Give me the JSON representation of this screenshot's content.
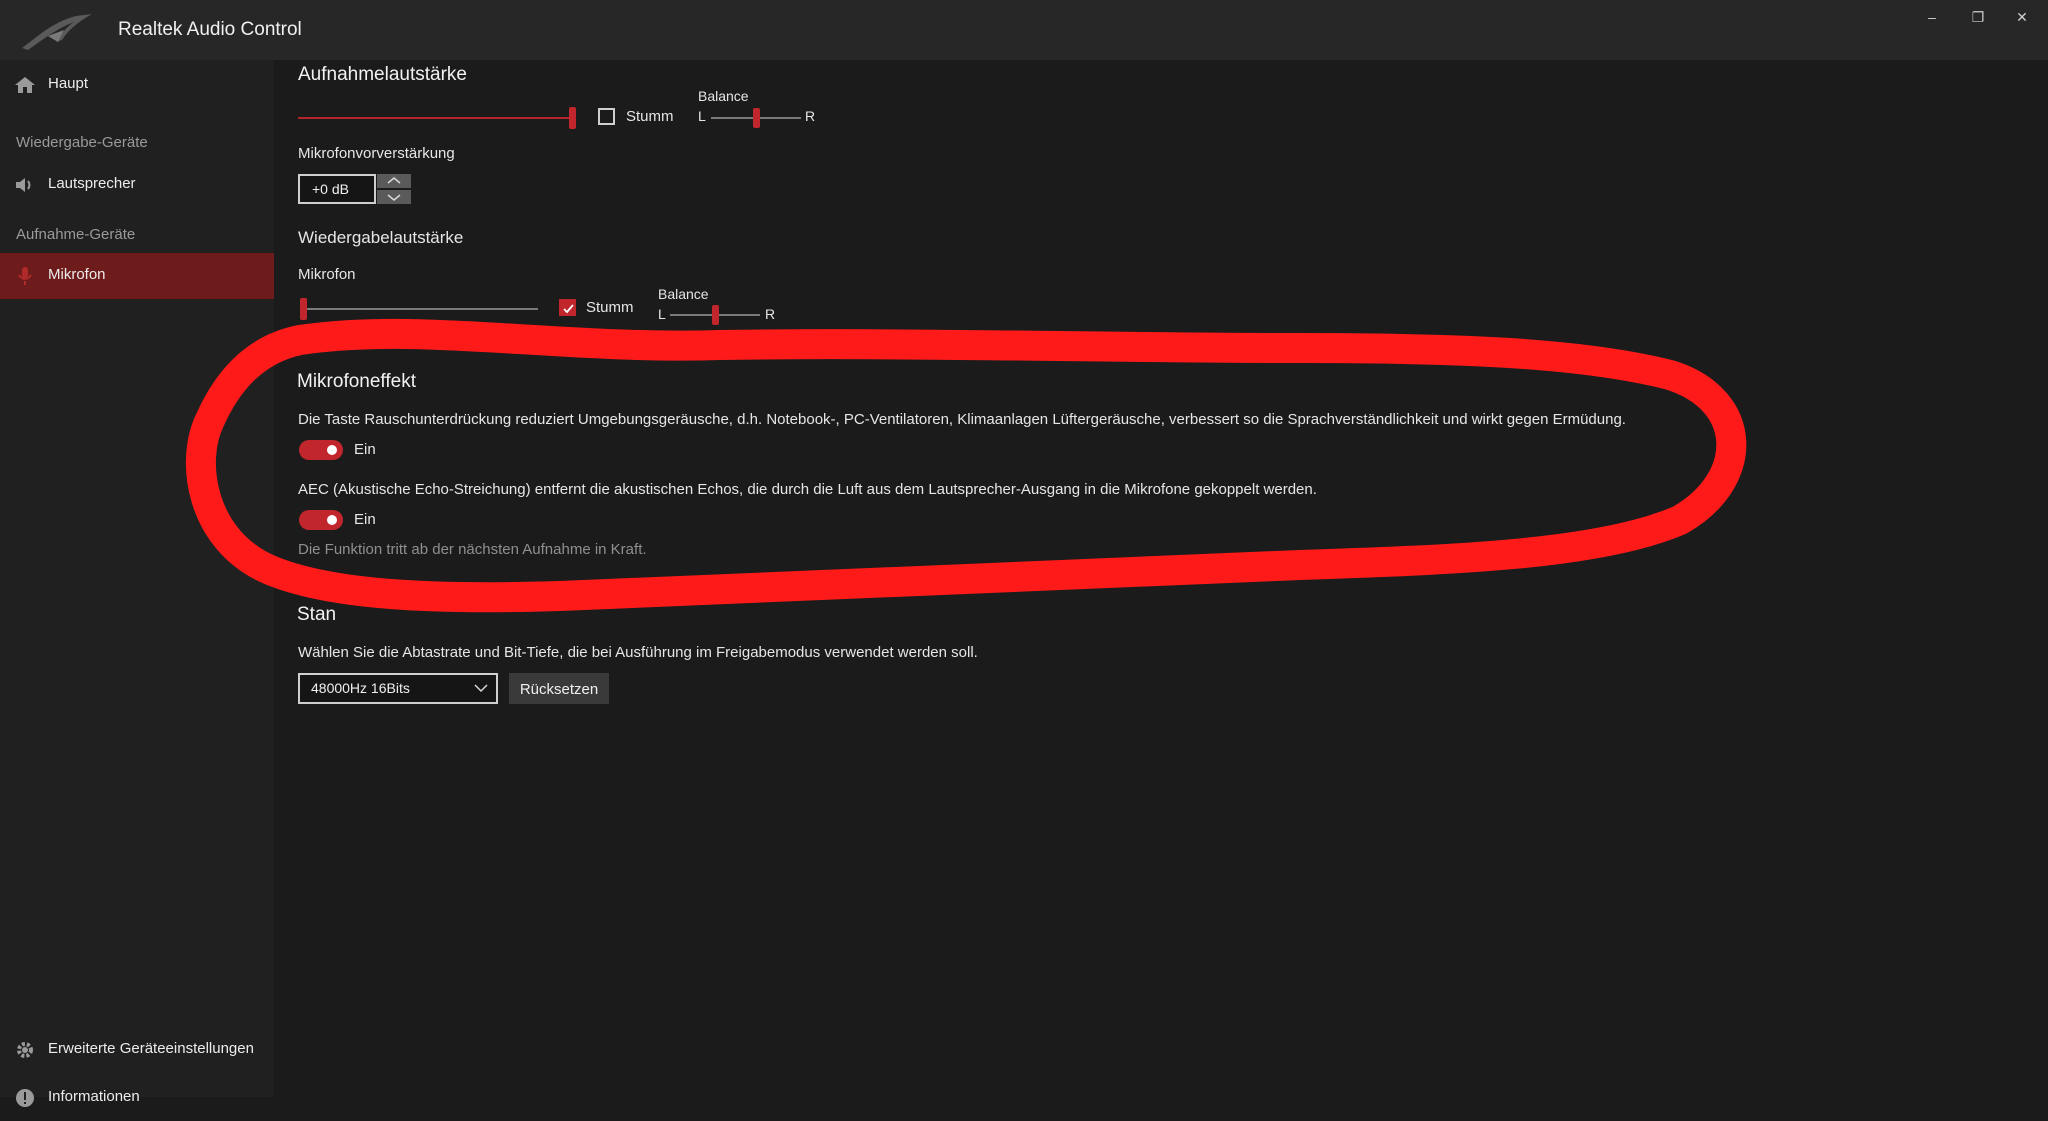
{
  "window": {
    "title": "Realtek Audio Control",
    "minimize": "–",
    "maximize": "❐",
    "close": "✕"
  },
  "sidebar": {
    "haupt": "Haupt",
    "playback_heading": "Wiedergabe-Geräte",
    "speakers": "Lautsprecher",
    "recording_heading": "Aufnahme-Geräte",
    "microphone": "Mikrofon",
    "advanced": "Erweiterte Geräteeinstellungen",
    "info": "Informationen"
  },
  "recording_volume": {
    "title": "Aufnahmelautstärke",
    "level": 1.0,
    "mute_label": "Stumm",
    "mute_checked": false,
    "balance_label": "Balance",
    "balance_left": "L",
    "balance_right": "R",
    "balance_value": 0.5
  },
  "mic_boost": {
    "label": "Mikrofonvorverstärkung",
    "value": "+0 dB"
  },
  "playback_volume": {
    "title": "Wiedergabelautstärke",
    "device_label": "Mikrofon",
    "level": 0.0,
    "mute_label": "Stumm",
    "mute_checked": true,
    "balance_label": "Balance",
    "balance_left": "L",
    "balance_right": "R",
    "balance_value": 0.5
  },
  "mic_effect": {
    "title": "Mikrofoneffekt",
    "noise_desc": "Die Taste Rauschunterdrückung reduziert Umgebungsgeräusche, d.h. Notebook-, PC-Ventilatoren, Klimaanlagen Lüftergeräusche, verbessert so die Sprachverständlichkeit und wirkt gegen Ermüdung.",
    "noise_toggle_label": "Ein",
    "aec_desc": "AEC (Akustische Echo-Streichung) entfernt die akustischen Echos, die durch die Luft aus dem Lautsprecher-Ausgang in die Mikrofone gekoppelt werden.",
    "aec_toggle_label": "Ein",
    "note": "Die Funktion tritt ab der nächsten Aufnahme in Kraft."
  },
  "default_format": {
    "title_partial": "Stan",
    "desc": "Wählen Sie die Abtastrate und Bit-Tiefe, die bei Ausführung im Freigabemodus verwendet werden soll.",
    "selected": "48000Hz 16Bits",
    "reset_label": "Rücksetzen"
  },
  "colors": {
    "accent": "#c0262c",
    "annotation": "#ff1a1a",
    "background": "#1b1b1b",
    "sidebar": "#202020"
  }
}
